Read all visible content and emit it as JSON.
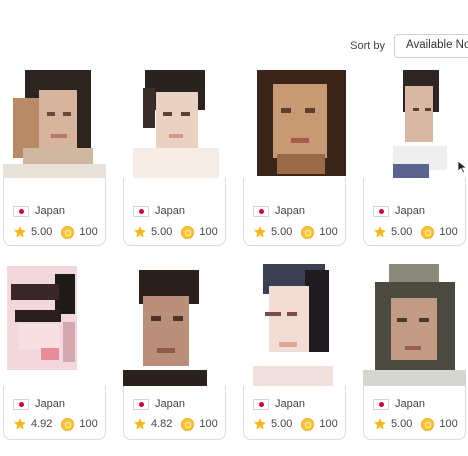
{
  "sort": {
    "label": "Sort by",
    "selected": "Available Now"
  },
  "tutors": [
    {
      "country": "Japan",
      "rating": "5.00",
      "price": "100"
    },
    {
      "country": "Japan",
      "rating": "5.00",
      "price": "100"
    },
    {
      "country": "Japan",
      "rating": "5.00",
      "price": "100"
    },
    {
      "country": "Japan",
      "rating": "5.00",
      "price": "100"
    },
    {
      "country": "Japan",
      "rating": "4.92",
      "price": "100"
    },
    {
      "country": "Japan",
      "rating": "4.82",
      "price": "100"
    },
    {
      "country": "Japan",
      "rating": "5.00",
      "price": "100"
    },
    {
      "country": "Japan",
      "rating": "5.00",
      "price": "100"
    }
  ],
  "icons": {
    "flag": "japan-flag-icon",
    "rating": "star-icon",
    "price": "coin-icon"
  },
  "colors": {
    "star": "#f5b820",
    "coin": "#f7c63c",
    "flag_red": "#d3002c",
    "card_border": "#dcdcdc"
  }
}
